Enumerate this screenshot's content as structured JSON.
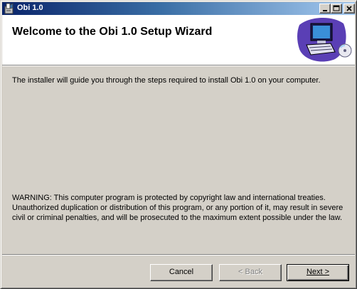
{
  "window": {
    "title": "Obi 1.0",
    "app_icon": "installer-box-icon",
    "caption_buttons": [
      "minimize-icon",
      "maximize-icon",
      "close-icon"
    ]
  },
  "banner": {
    "title": "Welcome to the Obi 1.0 Setup Wizard",
    "art_icon": "computer-with-cd-icon"
  },
  "body": {
    "intro": "The installer will guide you through the steps required to install Obi 1.0 on your computer.",
    "warning": "WARNING: This computer program is protected by copyright law and international treaties. Unauthorized duplication or distribution of this program, or any portion of it, may result in severe civil or criminal penalties, and will be prosecuted to the maximum extent possible under the law."
  },
  "buttons": {
    "cancel": "Cancel",
    "back": "< Back",
    "next": "Next >"
  },
  "colors": {
    "title_bar_start": "#0a246a",
    "title_bar_end": "#a6caf0",
    "face": "#d4d0c8",
    "banner": "#ffffff",
    "disabled_text": "#808080"
  }
}
